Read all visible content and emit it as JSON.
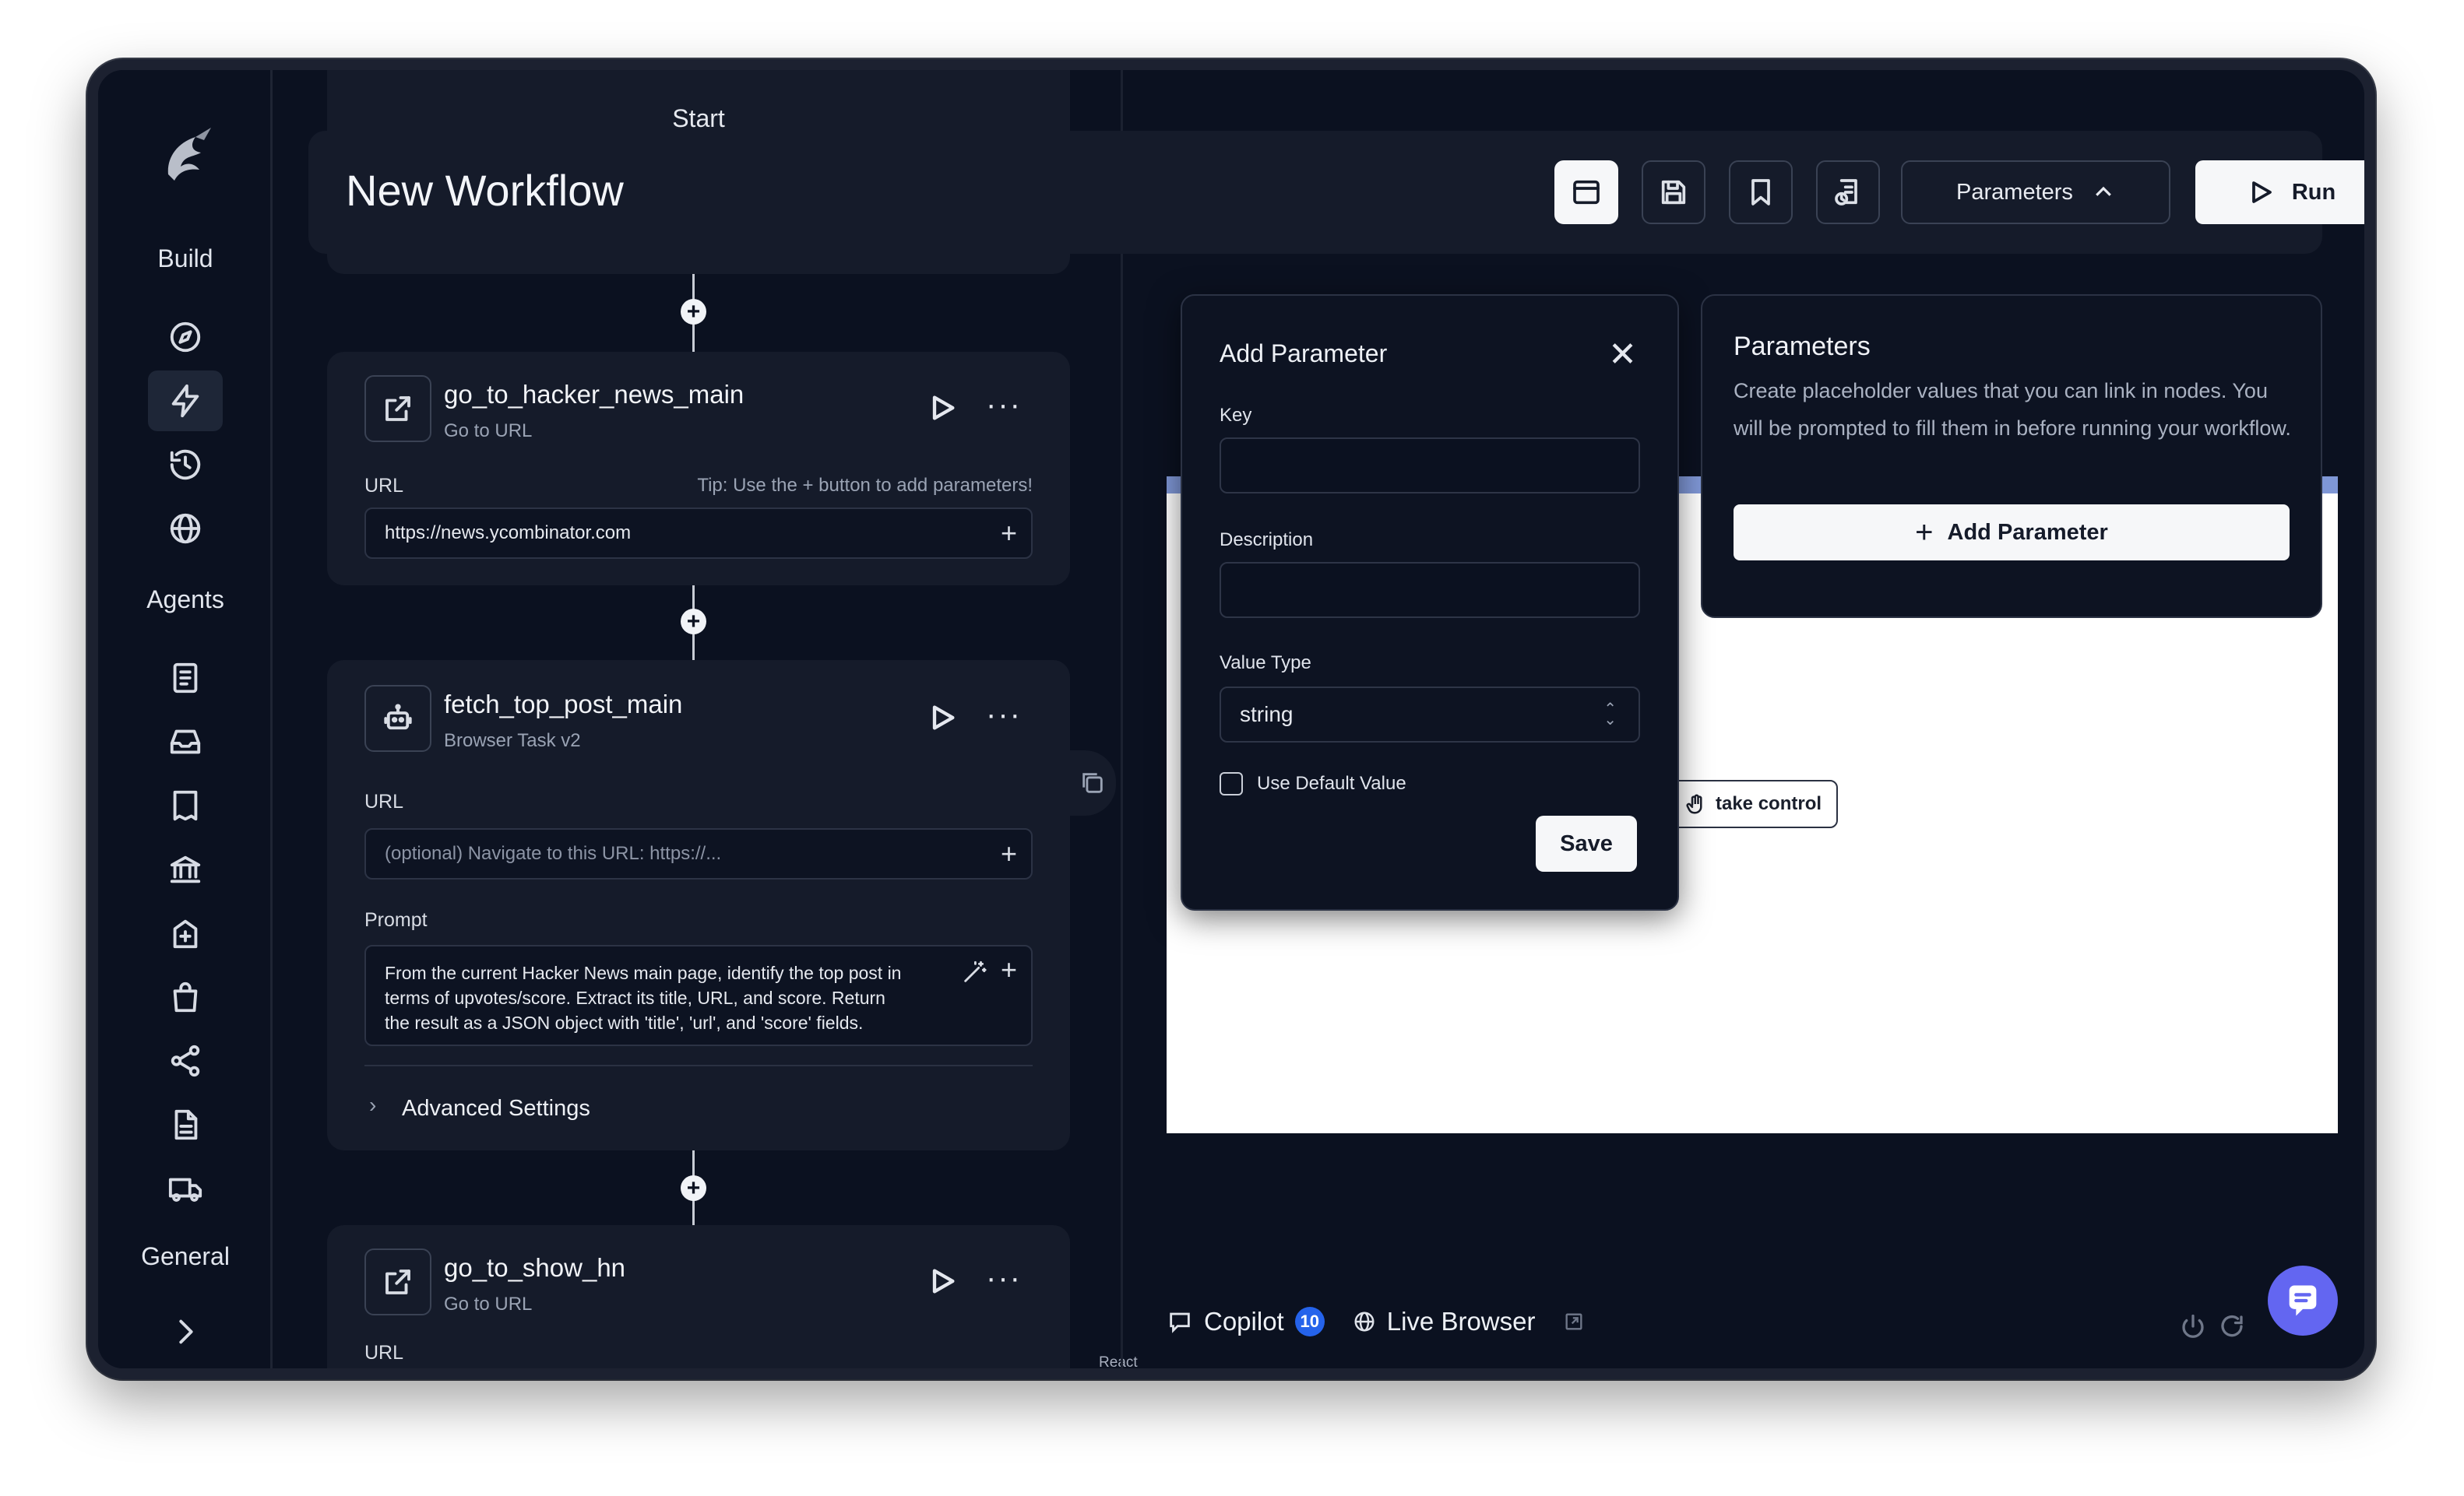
{
  "sidebar": {
    "sections": {
      "build": "Build",
      "agents": "Agents",
      "general": "General"
    }
  },
  "header": {
    "title": "New Workflow",
    "parameters_label": "Parameters",
    "run_label": "Run"
  },
  "canvas": {
    "start_label": "Start",
    "react_flow_label": "React Flow",
    "nodes": [
      {
        "title": "go_to_hacker_news_main",
        "subtitle": "Go to URL",
        "url_label": "URL",
        "tip": "Tip: Use the + button to add parameters!",
        "url_value": "https://news.ycombinator.com"
      },
      {
        "title": "fetch_top_post_main",
        "subtitle": "Browser Task v2",
        "url_label": "URL",
        "url_placeholder": "(optional) Navigate to this URL: https://...",
        "prompt_label": "Prompt",
        "prompt_lines": [
          "From the current Hacker News main page, identify the top post in",
          "terms of upvotes/score. Extract its title, URL, and score. Return",
          "the result as a JSON object with 'title', 'url', and 'score' fields."
        ],
        "advanced_label": "Advanced Settings"
      },
      {
        "title": "go_to_show_hn",
        "subtitle": "Go to URL",
        "url_label": "URL"
      }
    ]
  },
  "add_parameter_modal": {
    "title": "Add Parameter",
    "key_label": "Key",
    "description_label": "Description",
    "value_type_label": "Value Type",
    "value_type_selected": "string",
    "default_checkbox_label": "Use Default Value",
    "save_label": "Save"
  },
  "parameters_panel": {
    "title": "Parameters",
    "description": "Create placeholder values that you can link in nodes. You will be prompted to fill them in before running your workflow.",
    "add_label": "Add Parameter"
  },
  "browser": {
    "take_control_label": "take control"
  },
  "bottom_bar": {
    "copilot_label": "Copilot",
    "copilot_count": "10",
    "live_browser_label": "Live Browser"
  },
  "colors": {
    "background": "#0b1120",
    "panel": "#151b2a",
    "accent_badge": "#2563eb",
    "chat_button": "#6366f1"
  }
}
